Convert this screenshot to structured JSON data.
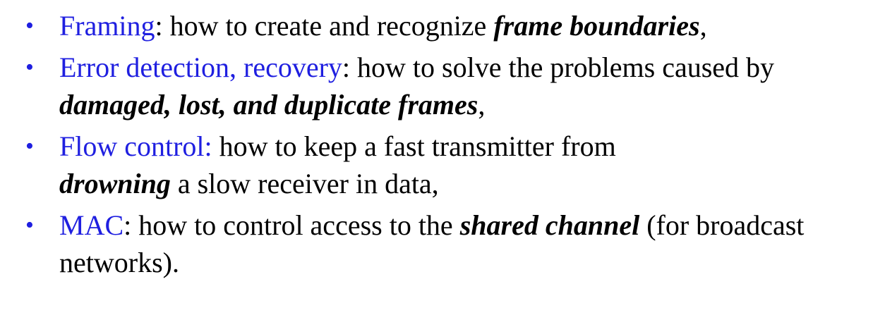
{
  "bullet_symbol": "•",
  "colors": {
    "term": "#1f1fe0",
    "text": "#000000",
    "background": "#ffffff"
  },
  "items": [
    {
      "term": "Framing",
      "after_term": ": how to create and recognize ",
      "emphasis": "frame boundaries",
      "tail": ","
    },
    {
      "term": "Error detection, recovery",
      "after_term": ": how to solve the problems caused by ",
      "emphasis": "damaged, lost, and duplicate frames",
      "tail": ","
    },
    {
      "term": "Flow control:",
      "after_term": " how to keep a fast transmitter from ",
      "emphasis": "drowning",
      "tail": " a slow receiver in data,"
    },
    {
      "term": "MAC",
      "after_term": ": how to control access to the ",
      "emphasis": "shared channel",
      "tail": " (for broadcast networks)."
    }
  ]
}
